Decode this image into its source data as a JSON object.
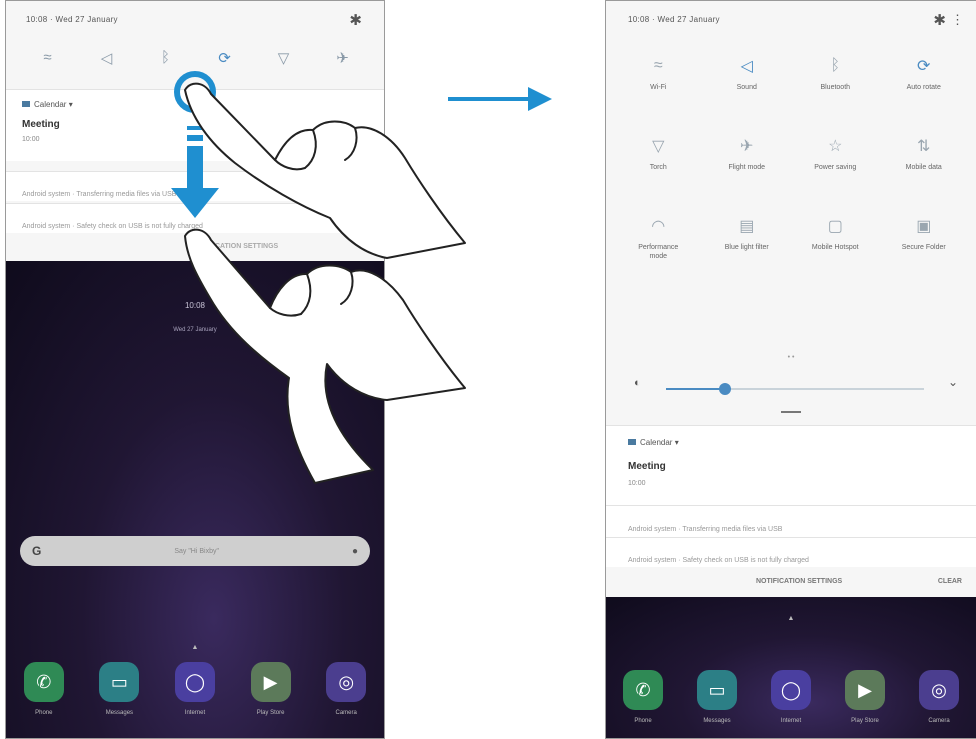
{
  "left": {
    "status_time": "10:08 · Wed 27 January",
    "quick_icons": [
      {
        "icon": "wifi-icon",
        "glyph": "≈",
        "on": false
      },
      {
        "icon": "sound-icon",
        "glyph": "◁",
        "on": false
      },
      {
        "icon": "bluetooth-icon",
        "glyph": "ᛒ",
        "on": false
      },
      {
        "icon": "auto-rotate-icon",
        "glyph": "⟳",
        "on": true
      },
      {
        "icon": "torch-icon",
        "glyph": "▽",
        "on": false
      },
      {
        "icon": "flight-mode-icon",
        "glyph": "✈",
        "on": false
      }
    ],
    "notification": {
      "app": "Calendar",
      "title": "Meeting",
      "time": "10:00"
    },
    "notice1": "Android system · Transferring media files via USB",
    "notice2": "Android system · Safety check on USB is not fully charged",
    "settings_label": "NOTIFICATION SETTINGS",
    "lock_time": "10:08",
    "lock_date": "Wed 27 January",
    "search_hint": "Say \"Hi Bixby\"",
    "apps": [
      {
        "label": "Phone",
        "icon": "phone-icon",
        "glyph": "✆",
        "color": "#2f8a55"
      },
      {
        "label": "Messages",
        "icon": "messages-icon",
        "glyph": "▭",
        "color": "#2c7f86"
      },
      {
        "label": "Internet",
        "icon": "internet-icon",
        "glyph": "◯",
        "color": "#4a3fa0"
      },
      {
        "label": "Play Store",
        "icon": "play-store-icon",
        "glyph": "▶",
        "color": "#5c7a5a"
      },
      {
        "label": "Camera",
        "icon": "camera-icon",
        "glyph": "◎",
        "color": "#4b3e8f"
      }
    ],
    "home_hint": "Swipe up to open all apps"
  },
  "right": {
    "status_time": "10:08 · Wed 27 January",
    "tiles": [
      {
        "label": "Wi-Fi",
        "icon": "wifi-icon",
        "glyph": "≈",
        "on": false
      },
      {
        "label": "Sound",
        "icon": "sound-icon",
        "glyph": "◁",
        "on": true
      },
      {
        "label": "Bluetooth",
        "icon": "bluetooth-icon",
        "glyph": "ᛒ",
        "on": false
      },
      {
        "label": "Auto rotate",
        "icon": "auto-rotate-icon",
        "glyph": "⟳",
        "on": true
      },
      {
        "label": "Torch",
        "icon": "torch-icon",
        "glyph": "▽",
        "on": false
      },
      {
        "label": "Flight mode",
        "icon": "flight-mode-icon",
        "glyph": "✈",
        "on": false
      },
      {
        "label": "Power saving",
        "icon": "power-saving-icon",
        "glyph": "☆",
        "on": false
      },
      {
        "label": "Mobile data",
        "icon": "mobile-data-icon",
        "glyph": "⇅",
        "on": false
      },
      {
        "label": "Performance mode",
        "icon": "performance-mode-icon",
        "glyph": "◠",
        "on": false
      },
      {
        "label": "Blue light filter",
        "icon": "blue-light-filter-icon",
        "glyph": "▤",
        "on": false
      },
      {
        "label": "Mobile Hotspot",
        "icon": "mobile-hotspot-icon",
        "glyph": "▢",
        "on": false
      },
      {
        "label": "Secure Folder",
        "icon": "secure-folder-icon",
        "glyph": "▣",
        "on": false
      }
    ],
    "page_dots": "• •",
    "brightness_fraction": 0.23,
    "notification": {
      "app": "Calendar",
      "title": "Meeting",
      "time": "10:00"
    },
    "notice1": "Android system · Transferring media files via USB",
    "notice2": "Android system · Safety check on USB is not fully charged",
    "settings_label": "NOTIFICATION SETTINGS",
    "clear_label": "CLEAR",
    "apps": [
      {
        "label": "Phone",
        "icon": "phone-icon",
        "glyph": "✆",
        "color": "#2f8a55"
      },
      {
        "label": "Messages",
        "icon": "messages-icon",
        "glyph": "▭",
        "color": "#2c7f86"
      },
      {
        "label": "Internet",
        "icon": "internet-icon",
        "glyph": "◯",
        "color": "#4a3fa0"
      },
      {
        "label": "Play Store",
        "icon": "play-store-icon",
        "glyph": "▶",
        "color": "#5c7a5a"
      },
      {
        "label": "Camera",
        "icon": "camera-icon",
        "glyph": "◎",
        "color": "#4b3e8f"
      }
    ]
  },
  "colors": {
    "accent": "#1f8fd0",
    "active": "#4a8bc2"
  }
}
